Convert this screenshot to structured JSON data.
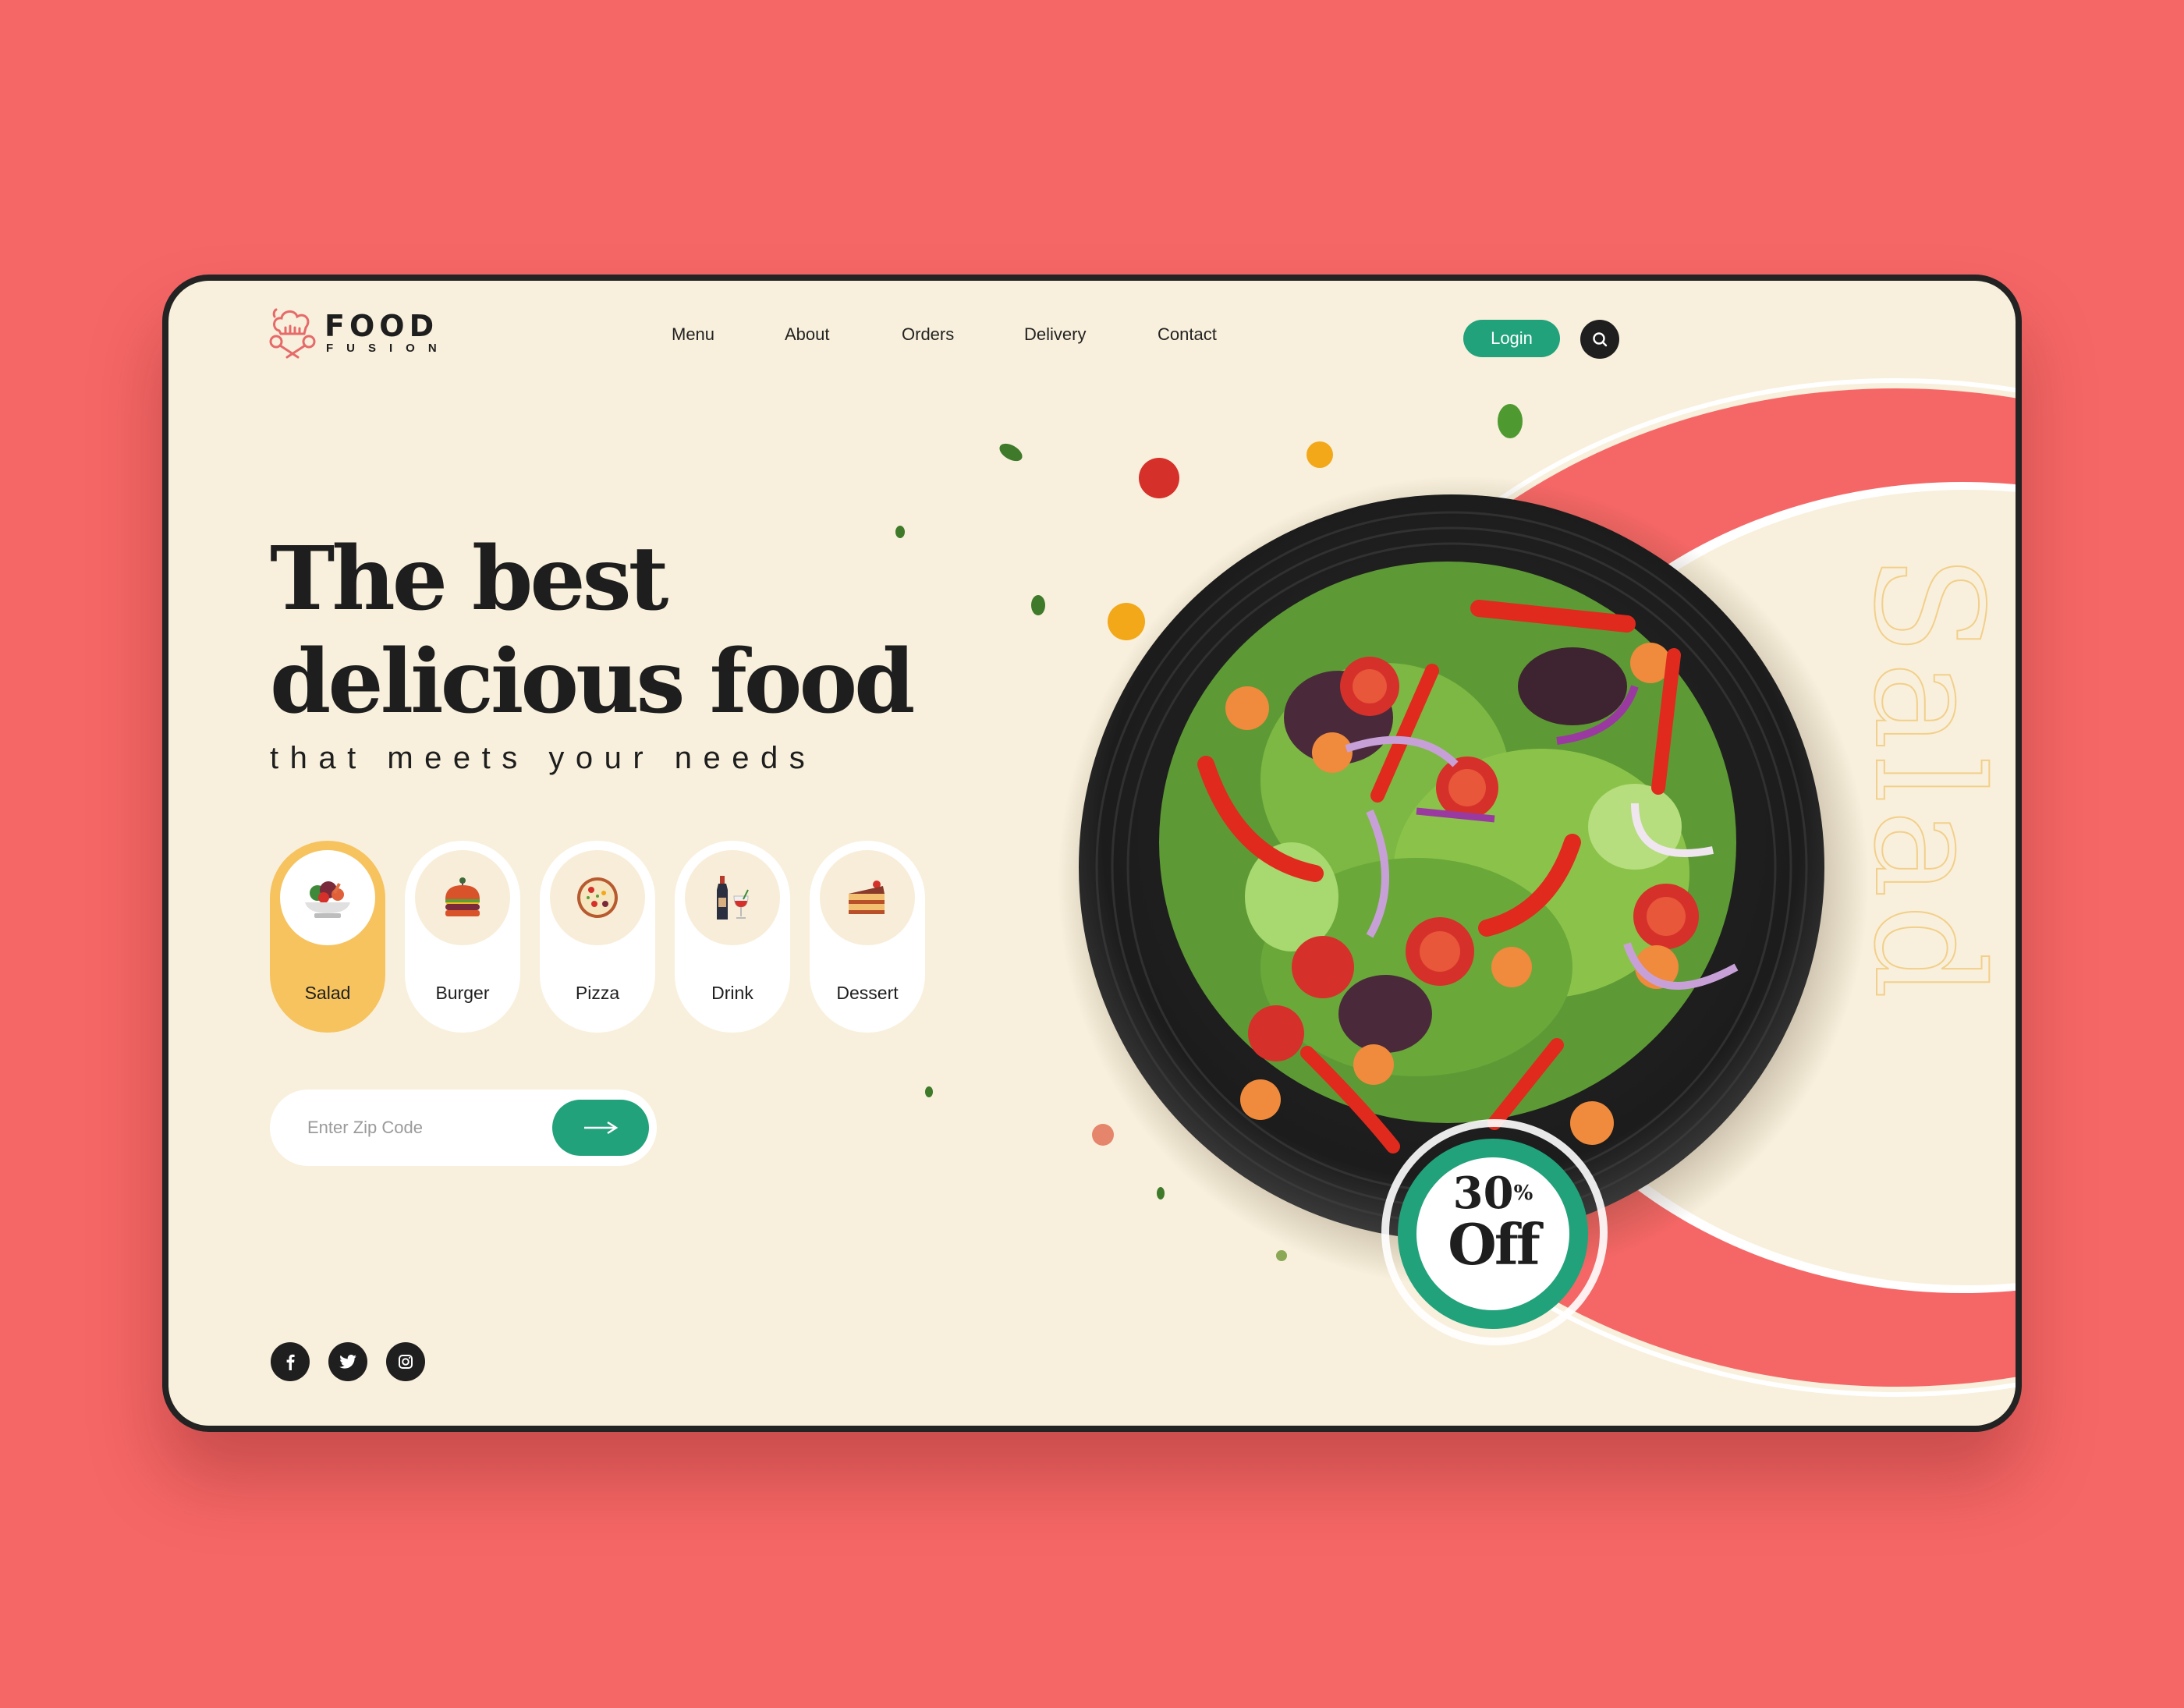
{
  "brand": {
    "name": "FOOD",
    "tagline": "FUSION",
    "logo_icon": "chef-hat-spoons-icon",
    "colors": {
      "accent_red": "#f56766",
      "accent_green": "#21a27b",
      "accent_yellow": "#f6c35f",
      "background": "#f8f0dc",
      "dark": "#1e1e1e"
    }
  },
  "nav": {
    "items": [
      {
        "label": "Menu"
      },
      {
        "label": "About"
      },
      {
        "label": "Orders"
      },
      {
        "label": "Delivery"
      },
      {
        "label": "Contact"
      }
    ],
    "login_label": "Login",
    "search_icon": "search-icon"
  },
  "hero": {
    "title_line1": "The best",
    "title_line2": "delicious food",
    "subtitle": "that meets your needs",
    "vertical_word": "Salad"
  },
  "categories": [
    {
      "label": "Salad",
      "icon": "salad-bowl-icon",
      "active": true
    },
    {
      "label": "Burger",
      "icon": "burger-icon",
      "active": false
    },
    {
      "label": "Pizza",
      "icon": "pizza-icon",
      "active": false
    },
    {
      "label": "Drink",
      "icon": "wine-icon",
      "active": false
    },
    {
      "label": "Dessert",
      "icon": "cake-slice-icon",
      "active": false
    }
  ],
  "zip": {
    "placeholder": "Enter Zip Code",
    "value": "",
    "submit_icon": "arrow-right-icon"
  },
  "socials": [
    {
      "name": "facebook",
      "icon": "facebook-icon"
    },
    {
      "name": "twitter",
      "icon": "twitter-icon"
    },
    {
      "name": "instagram",
      "icon": "instagram-icon"
    }
  ],
  "promo": {
    "amount": "30",
    "percent_sign": "%",
    "label": "Off"
  }
}
